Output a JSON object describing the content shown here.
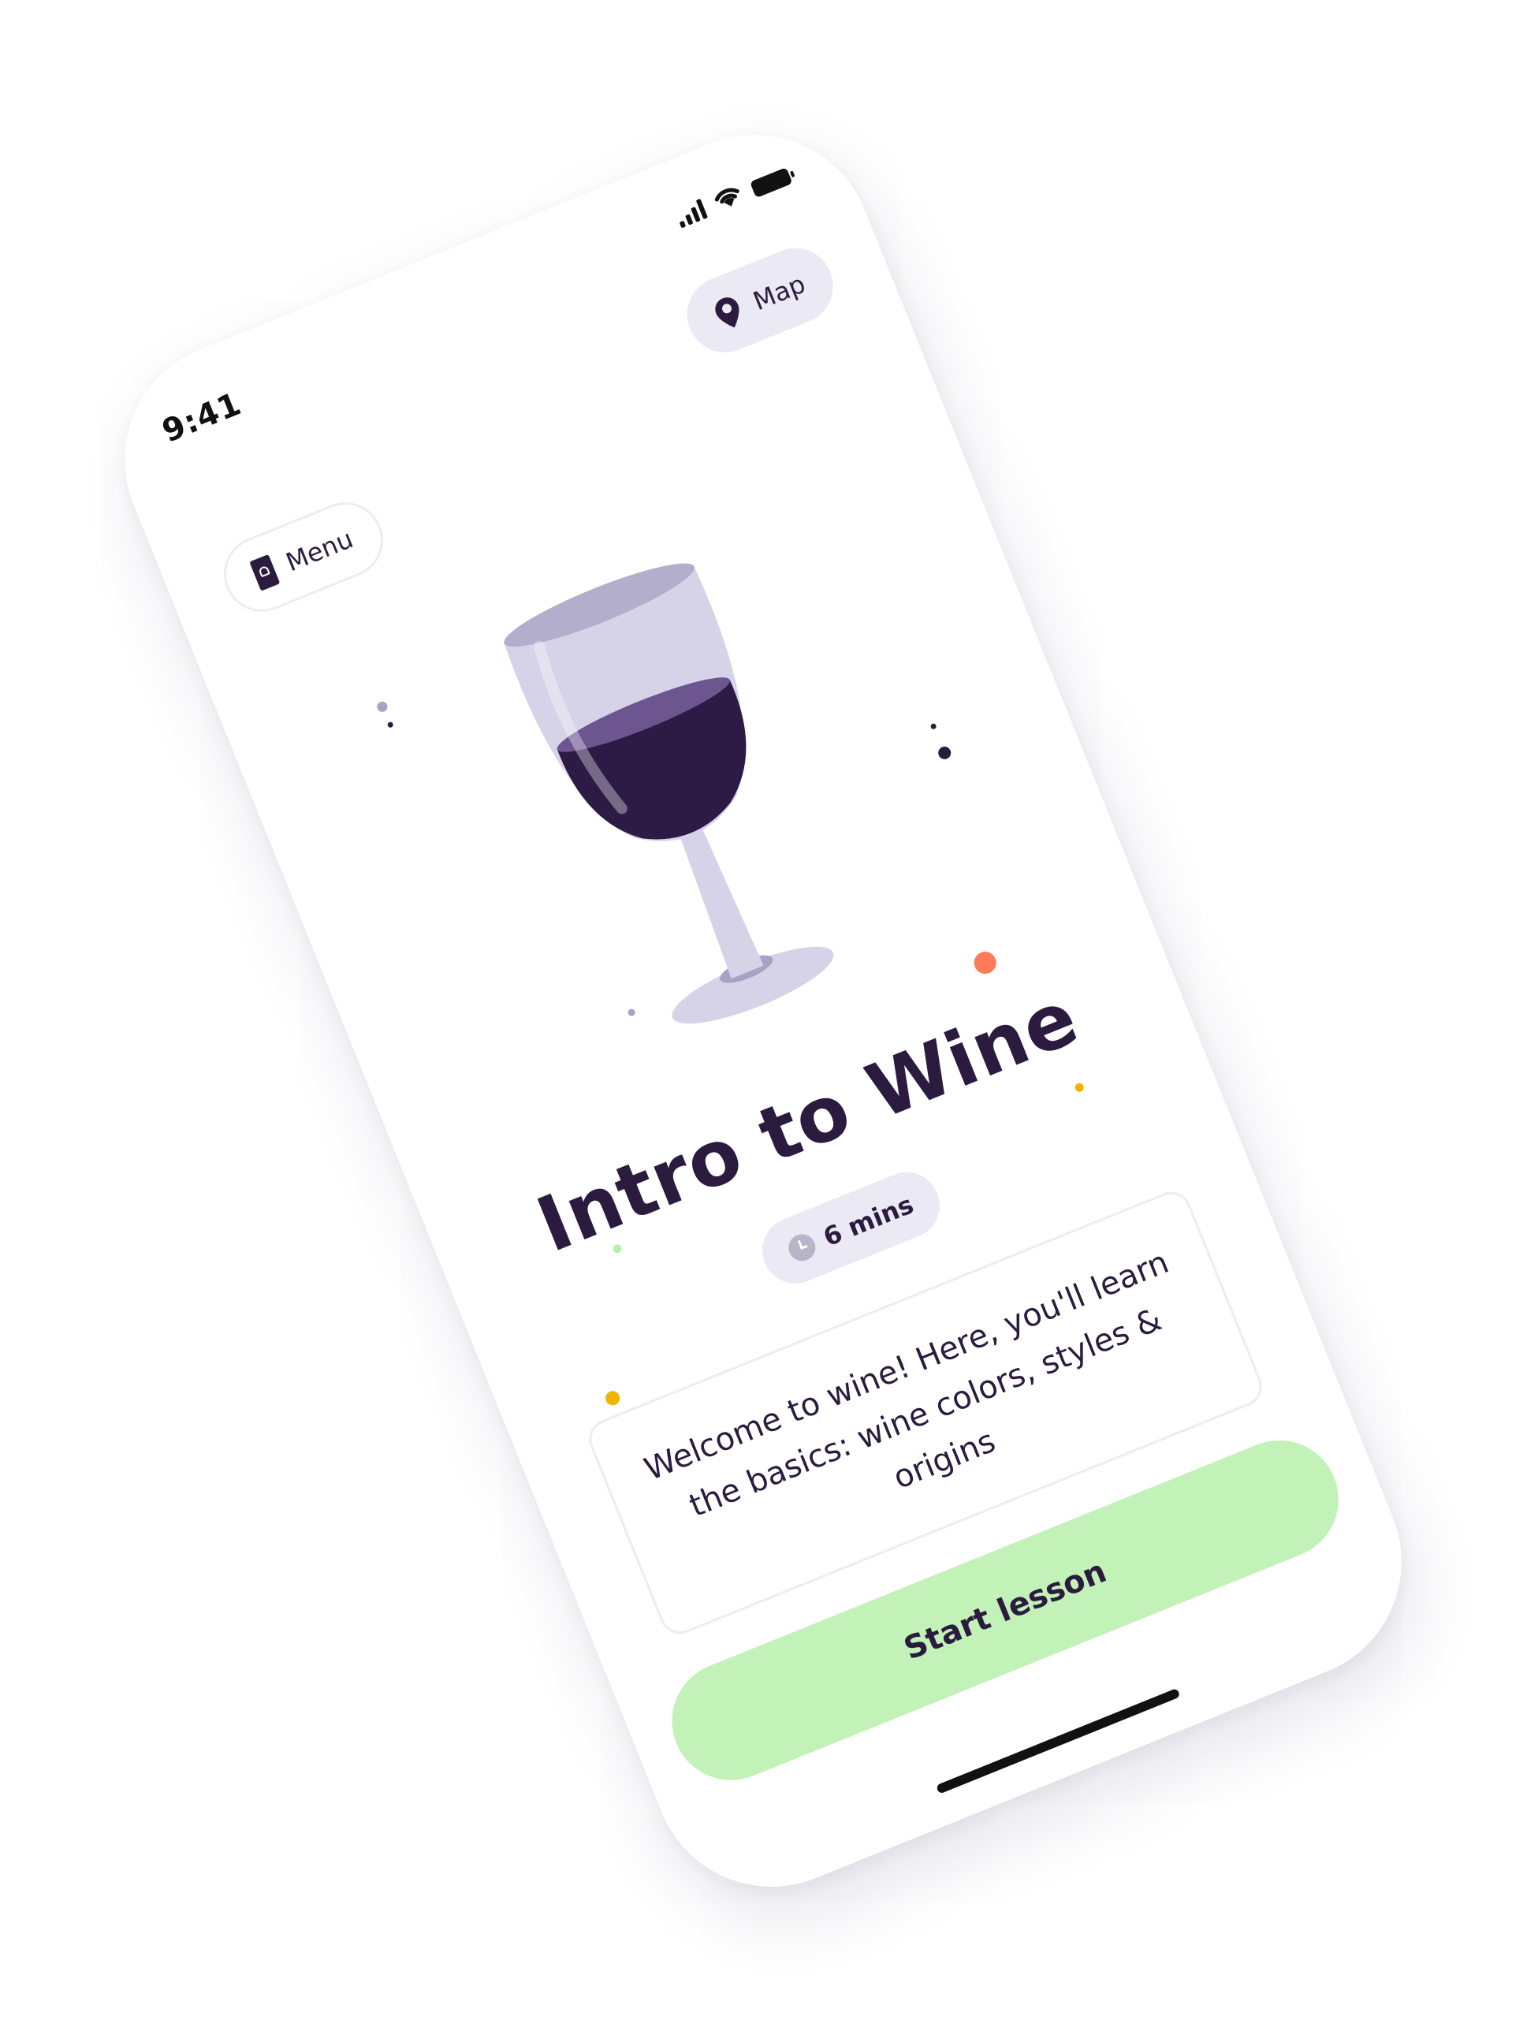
{
  "status_bar": {
    "time": "9:41",
    "signal_icon": "cellular-signal-icon",
    "wifi_icon": "wifi-icon",
    "battery_icon": "battery-icon"
  },
  "header": {
    "menu_label": "Menu",
    "menu_icon": "wine-menu-icon",
    "map_label": "Map",
    "map_icon": "map-pin-icon"
  },
  "lesson": {
    "illustration": "wine-glass-illustration",
    "title": "Intro to Wine",
    "duration": "6 mins",
    "duration_icon": "clock-icon",
    "description": "Welcome to wine! Here, you'll learn the basics: wine colors, styles & origins"
  },
  "actions": {
    "start_label": "Start lesson"
  },
  "colors": {
    "primary_text": "#2b1c3f",
    "accent_green": "#c3f2b8",
    "pill_background": "#ebe9f3",
    "wine": "#2e1b45",
    "glass": "#d6d3e8",
    "confetti_orange": "#ff7a59",
    "confetti_yellow": "#f0b400",
    "confetti_green": "#b8efad"
  }
}
